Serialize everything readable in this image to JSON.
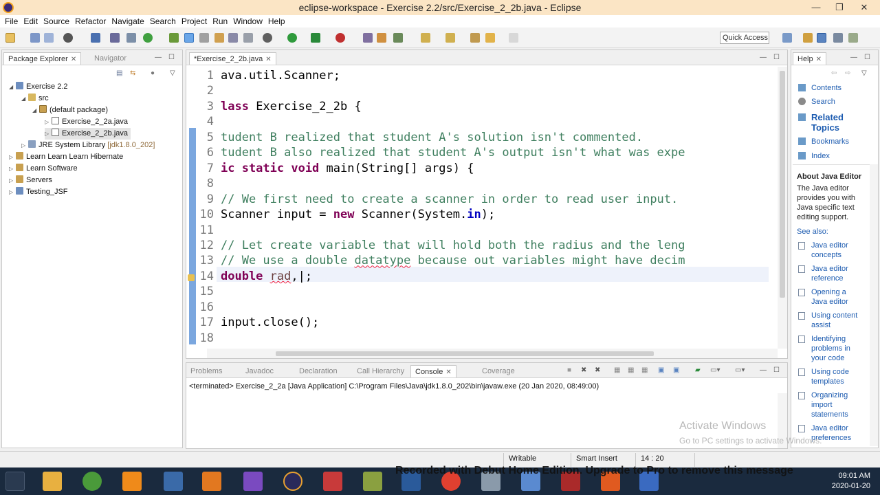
{
  "window": {
    "title": "eclipse-workspace - Exercise 2.2/src/Exercise_2_2b.java - Eclipse",
    "min": "—",
    "max": "❐",
    "close": "✕"
  },
  "menu": [
    "File",
    "Edit",
    "Source",
    "Refactor",
    "Navigate",
    "Search",
    "Project",
    "Run",
    "Window",
    "Help"
  ],
  "toolbar": {
    "quick_access": "Quick Access"
  },
  "package_explorer": {
    "tab_label": "Package Explorer",
    "navigator_label": "Navigator",
    "tree": [
      {
        "label": "Exercise 2.2",
        "icon": "project-icon"
      },
      {
        "label": "src",
        "icon": "source-folder-icon"
      },
      {
        "label": "(default package)",
        "icon": "package-icon"
      },
      {
        "label": "Exercise_2_2a.java",
        "icon": "java-file-icon"
      },
      {
        "label": "Exercise_2_2b.java",
        "icon": "java-file-icon"
      },
      {
        "label": "JRE System Library",
        "deco": "[jdk1.8.0_202]",
        "icon": "library-icon"
      },
      {
        "label": "Learn Learn Learn Hibernate",
        "icon": "project-icon"
      },
      {
        "label": "Learn Software",
        "icon": "project-icon"
      },
      {
        "label": "Servers",
        "icon": "project-icon"
      },
      {
        "label": "Testing_JSF",
        "icon": "project-icon"
      }
    ]
  },
  "editor": {
    "tab_label": "*Exercise_2_2b.java",
    "lines": [
      {
        "n": "1",
        "segs": [
          {
            "t": "ava.util.Scanner;",
            "c": ""
          }
        ]
      },
      {
        "n": "2",
        "segs": []
      },
      {
        "n": "3",
        "segs": [
          {
            "t": "lass",
            "c": "kw"
          },
          {
            "t": " Exercise_2_2b {",
            "c": ""
          }
        ]
      },
      {
        "n": "4",
        "segs": []
      },
      {
        "n": "5",
        "segs": [
          {
            "t": "tudent B realized that student A's solution isn't commented.",
            "c": "cm"
          }
        ]
      },
      {
        "n": "6",
        "segs": [
          {
            "t": "tudent B also realized that student A's output isn't what was expe",
            "c": "cm"
          }
        ]
      },
      {
        "n": "7",
        "segs": [
          {
            "t": "ic static void",
            "c": "kw"
          },
          {
            "t": " main(String[] args) {",
            "c": ""
          }
        ]
      },
      {
        "n": "8",
        "segs": []
      },
      {
        "n": "9",
        "segs": [
          {
            "t": "// We first need to create a scanner in order to read user input.",
            "c": "cm"
          }
        ]
      },
      {
        "n": "10",
        "segs": [
          {
            "t": "Scanner input = ",
            "c": ""
          },
          {
            "t": "new",
            "c": "kw"
          },
          {
            "t": " Scanner(System.",
            "c": ""
          },
          {
            "t": "in",
            "c": "fld"
          },
          {
            "t": ");",
            "c": ""
          }
        ]
      },
      {
        "n": "11",
        "segs": []
      },
      {
        "n": "12",
        "segs": [
          {
            "t": "// Let create variable that will hold both the radius and the leng",
            "c": "cm"
          }
        ]
      },
      {
        "n": "13",
        "segs": [
          {
            "t": "// We use a double ",
            "c": "cm"
          },
          {
            "t": "datatype",
            "c": "cm squig"
          },
          {
            "t": " because out variables might have decim",
            "c": "cm"
          }
        ]
      },
      {
        "n": "14",
        "segs": [
          {
            "t": "double",
            "c": "kw"
          },
          {
            "t": " ",
            "c": ""
          },
          {
            "t": "rad",
            "c": "var squig"
          },
          {
            "t": ",|;",
            "c": ""
          }
        ]
      },
      {
        "n": "15",
        "segs": []
      },
      {
        "n": "16",
        "segs": []
      },
      {
        "n": "17",
        "segs": [
          {
            "t": "input.close();",
            "c": ""
          }
        ]
      },
      {
        "n": "18",
        "segs": []
      }
    ]
  },
  "bottom_tabs": {
    "problems": "Problems",
    "javadoc": "Javadoc",
    "declaration": "Declaration",
    "call_hierarchy": "Call Hierarchy",
    "console": "Console",
    "coverage": "Coverage"
  },
  "console": {
    "text": "<terminated> Exercise_2_2a [Java Application] C:\\Program Files\\Java\\jdk1.8.0_202\\bin\\javaw.exe (20 Jan 2020, 08:49:00)"
  },
  "help": {
    "tab_label": "Help",
    "links": [
      "Contents",
      "Search"
    ],
    "related_topics": "Related Topics",
    "links2": [
      "Bookmarks",
      "Index"
    ],
    "about_title": "About Java Editor",
    "about_text": [
      "The Java editor",
      "provides you with",
      "Java specific text",
      "editing support."
    ],
    "see_also": "See also:",
    "see_also_links": [
      [
        "Java editor",
        "concepts"
      ],
      [
        "Java editor",
        "reference"
      ],
      [
        "Opening a",
        "Java editor"
      ],
      [
        "Using content",
        "assist"
      ],
      [
        "Identifying",
        "problems in",
        "your code"
      ],
      [
        "Using code",
        "templates"
      ],
      [
        "Organizing",
        "import",
        "statements"
      ],
      [
        "Java editor",
        "preferences"
      ]
    ]
  },
  "status": {
    "writable": "Writable",
    "insert": "Smart Insert",
    "position": "14 : 20"
  },
  "overlays": {
    "activate_title": "Activate Windows",
    "activate_sub": "Go to PC settings to activate Windows.",
    "recorded": "Recorded with Debut Home Edition. Upgrade to Pro to remove this message"
  },
  "taskbar": {
    "time": "09:01 AM",
    "date": "2020-01-20"
  }
}
